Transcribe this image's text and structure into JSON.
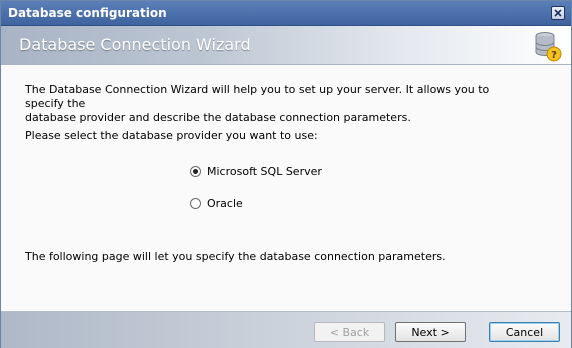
{
  "window": {
    "title": "Database configuration"
  },
  "header": {
    "title": "Database Connection Wizard",
    "icon": "database-help-icon"
  },
  "content": {
    "intro_line1": "The Database Connection Wizard will help you to set up your server. It allows you to specify the",
    "intro_line2": "database provider and describe the database connection parameters.",
    "prompt": "Please select the database provider you want to use:",
    "providers": [
      {
        "label": "Microsoft SQL Server",
        "selected": true
      },
      {
        "label": "Oracle",
        "selected": false
      }
    ],
    "following": "The following page will let you specify the database connection parameters."
  },
  "footer": {
    "back_label": "< Back",
    "next_label": "Next >",
    "cancel_label": "Cancel"
  }
}
